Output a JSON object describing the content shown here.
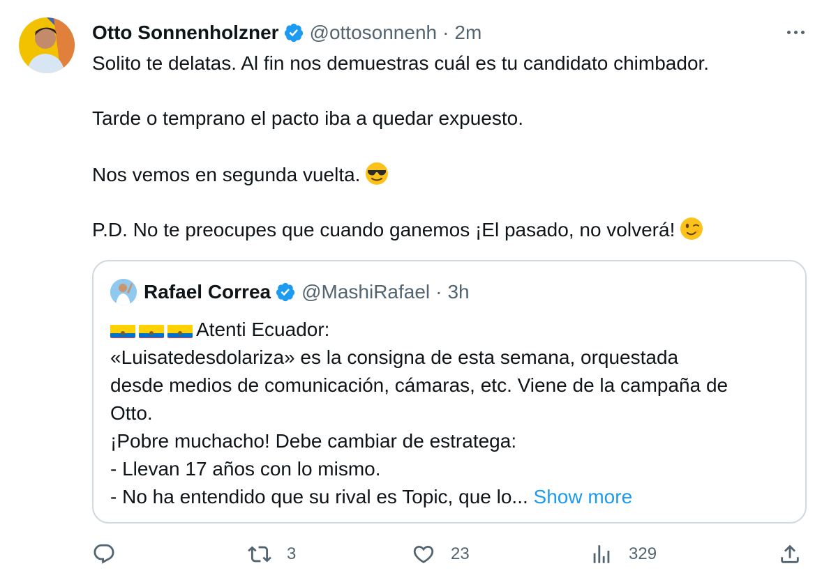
{
  "author": {
    "name": "Otto Sonnenholzner",
    "handle": "@ottosonnenh",
    "time": "2m"
  },
  "tweet": {
    "line1": "Solito te delatas. Al fin nos demuestras cuál es tu candidato chimbador.",
    "line2": "Tarde o temprano el pacto iba a quedar expuesto.",
    "line3": "Nos vemos en segunda vuelta.",
    "line4": "P.D. No te preocupes que cuando ganemos ¡El pasado, no volverá!"
  },
  "quote": {
    "name": "Rafael Correa",
    "handle": "@MashiRafael",
    "time": "3h",
    "lines": [
      "Atenti Ecuador:",
      "«Luisatedesdolariza» es la consigna de esta semana, orquestada",
      "desde medios de comunicación, cámaras, etc. Viene de la campaña de",
      "Otto.",
      "¡Pobre muchacho! Debe cambiar de estratega:",
      "- Llevan 17 años con lo mismo.",
      "- No ha entendido que su rival es Topic, que lo..."
    ],
    "show_more": "Show more"
  },
  "actions": {
    "replies": "",
    "retweets": "3",
    "likes": "23",
    "views": "329"
  },
  "colors": {
    "accent": "#1d9bf0",
    "muted": "#536471",
    "border": "#cfd9de"
  },
  "icons": [
    "verified-badge-icon",
    "more-icon",
    "reply-icon",
    "retweet-icon",
    "like-icon",
    "views-icon",
    "share-icon",
    "cool-emoji-icon",
    "wink-emoji-icon",
    "ecuador-flag-icon"
  ]
}
